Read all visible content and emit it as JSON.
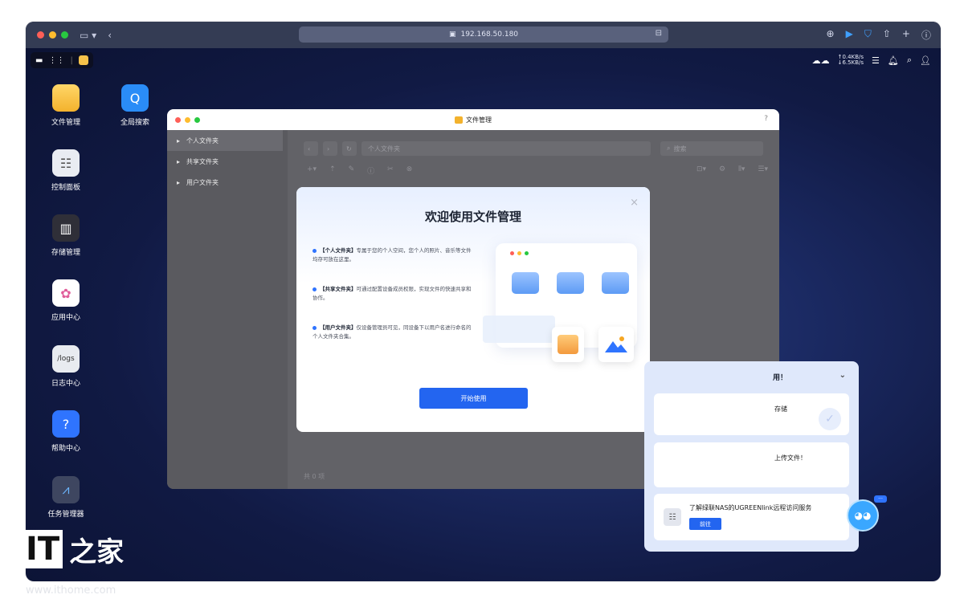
{
  "browser": {
    "url": "192.168.50.180",
    "colors": {
      "close": "#fe5f57",
      "min": "#febc2e",
      "max": "#28c840"
    }
  },
  "nas_top": {
    "upload_speed": "↑0.4KB/s",
    "download_speed": "↓6.5KB/s"
  },
  "desktop_icons": [
    {
      "label": "文件管理",
      "icon": "folder-icon"
    },
    {
      "label": "全局搜索",
      "icon": "search-icon"
    },
    {
      "label": "控制面板",
      "icon": "control-panel-icon"
    },
    {
      "label": "存储管理",
      "icon": "storage-icon"
    },
    {
      "label": "应用中心",
      "icon": "app-center-icon"
    },
    {
      "label": "日志中心",
      "icon": "log-icon",
      "icon_text": "/logs"
    },
    {
      "label": "帮助中心",
      "icon": "help-icon",
      "icon_text": "?"
    },
    {
      "label": "任务管理器",
      "icon": "task-manager-icon"
    }
  ],
  "file_manager": {
    "title": "文件管理",
    "help": "?",
    "sidebar": [
      {
        "label": "个人文件夹"
      },
      {
        "label": "共享文件夹"
      },
      {
        "label": "用户文件夹"
      }
    ],
    "path": "个人文件夹",
    "search_placeholder": "搜索",
    "footer": "共 0 项"
  },
  "welcome_modal": {
    "title": "欢迎使用文件管理",
    "close": "×",
    "features": [
      {
        "name": "【个人文件夹】",
        "desc": "专属于您的个人空间，您个人的照片、音乐等文件均存可放在这里。"
      },
      {
        "name": "【共享文件夹】",
        "desc": "可通过配置设备成员权限，实现文件的快速共享和协作。"
      },
      {
        "name": "【用户文件夹】",
        "desc": "仅设备管理员可见，同设备下以用户名进行命名的个人文件夹合集。"
      }
    ],
    "start_button": "开始使用"
  },
  "guide_panel": {
    "title": "用！",
    "card1_text": "存储",
    "card2_text": "上传文件！",
    "card3_text": "了解绿联NAS的UGREENlink远程访问服务",
    "card3_button": "前往"
  },
  "watermark": {
    "brand_it": "IT",
    "brand_zh": "之家",
    "url": "www.ithome.com"
  }
}
